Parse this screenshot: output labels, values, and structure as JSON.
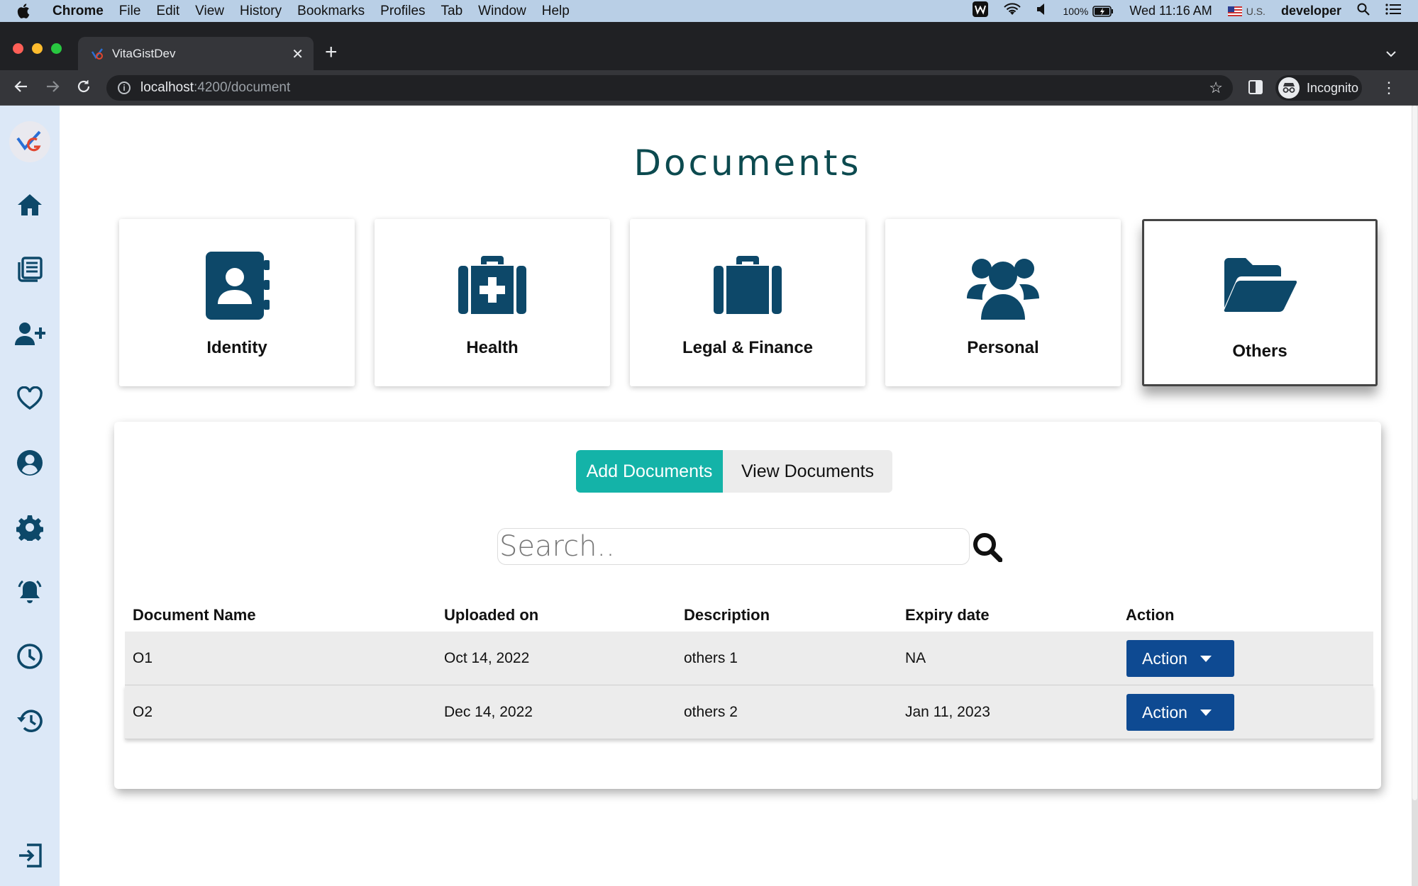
{
  "menubar": {
    "app_name": "Chrome",
    "items": [
      "File",
      "Edit",
      "View",
      "History",
      "Bookmarks",
      "Profiles",
      "Tab",
      "Window",
      "Help"
    ],
    "battery": "100%",
    "datetime": "Wed 11:16 AM",
    "locale": "U.S.",
    "user": "developer"
  },
  "browser": {
    "tab_title": "VitaGistDev",
    "url_host": "localhost",
    "url_rest": ":4200/document",
    "profile_label": "Incognito"
  },
  "page": {
    "title": "Documents"
  },
  "categories": [
    {
      "label": "Identity",
      "icon": "address-book-icon"
    },
    {
      "label": "Health",
      "icon": "medkit-icon"
    },
    {
      "label": "Legal & Finance",
      "icon": "briefcase-icon"
    },
    {
      "label": "Personal",
      "icon": "users-icon"
    },
    {
      "label": "Others",
      "icon": "folder-open-icon",
      "selected": true
    }
  ],
  "toggle": {
    "add_label": "Add Documents",
    "view_label": "View Documents",
    "active": "Add Documents"
  },
  "search": {
    "placeholder": "Search.."
  },
  "table": {
    "headers": [
      "Document Name",
      "Uploaded on",
      "Description",
      "Expiry date",
      "Action"
    ],
    "rows": [
      {
        "name": "O1",
        "uploaded": "Oct 14, 2022",
        "description": "others 1",
        "expiry": "NA",
        "action": "Action"
      },
      {
        "name": "O2",
        "uploaded": "Dec 14, 2022",
        "description": "others 2",
        "expiry": "Jan 11, 2023",
        "action": "Action"
      }
    ]
  },
  "colors": {
    "accent_teal": "#14b3a8",
    "icon_navy": "#0d4869",
    "action_blue": "#0e4a92",
    "title_teal": "#0c4a4f",
    "sidebar_bg": "#dce8f7"
  }
}
